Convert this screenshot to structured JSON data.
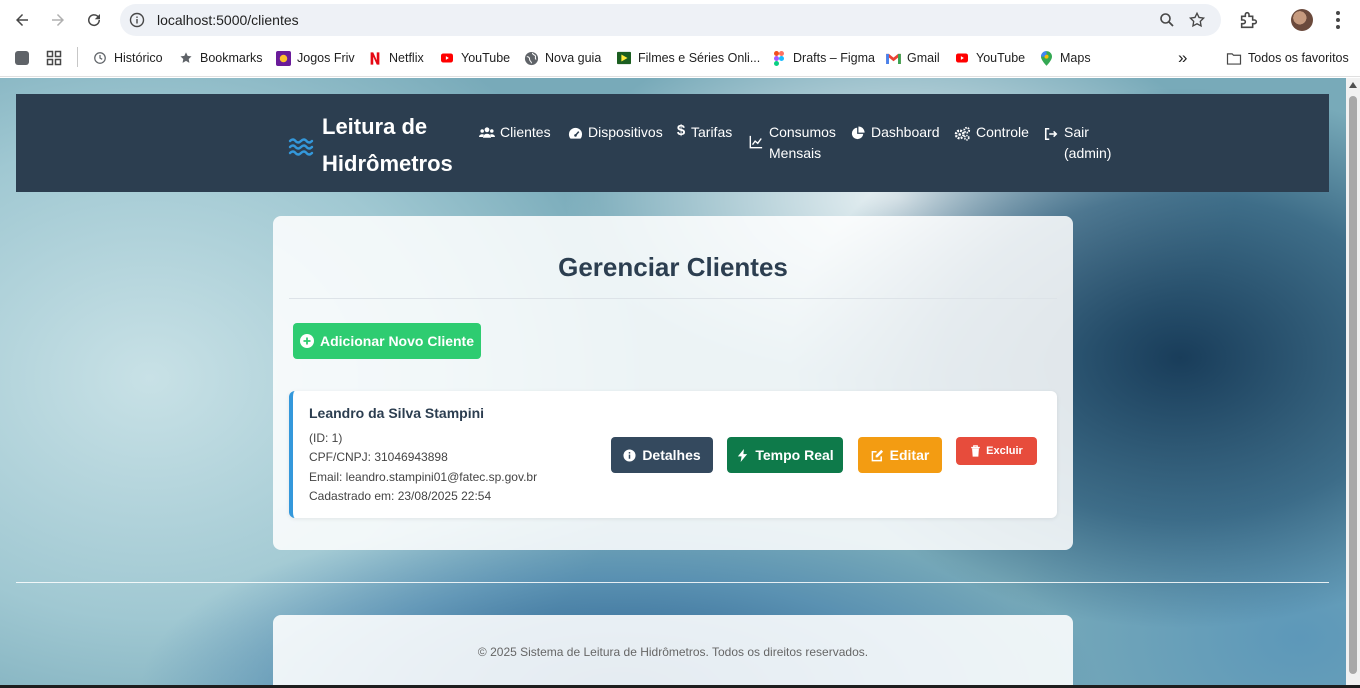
{
  "browser": {
    "url": "localhost:5000/clientes",
    "bookmarks": [
      {
        "label": "Histórico",
        "icon": "history-icon"
      },
      {
        "label": "Bookmarks",
        "icon": "star-icon"
      },
      {
        "label": "Jogos Friv",
        "icon": "friv-icon"
      },
      {
        "label": "Netflix",
        "icon": "netflix-icon"
      },
      {
        "label": "YouTube",
        "icon": "youtube-icon"
      },
      {
        "label": "Nova guia",
        "icon": "globe-icon"
      },
      {
        "label": "Filmes e Séries Onli...",
        "icon": "film-icon"
      },
      {
        "label": "Drafts – Figma",
        "icon": "figma-icon"
      },
      {
        "label": "Gmail",
        "icon": "gmail-icon"
      },
      {
        "label": "YouTube",
        "icon": "youtube-icon"
      },
      {
        "label": "Maps",
        "icon": "maps-icon"
      }
    ],
    "overflow_label": "»",
    "all_bookmarks": "Todos os favoritos"
  },
  "navbar": {
    "brand": "Leitura de Hidrômetros",
    "items": [
      {
        "label": "Clientes",
        "icon": "users-icon"
      },
      {
        "label": "Dispositivos",
        "icon": "gauge-icon"
      },
      {
        "label": "Tarifas",
        "icon": "dollar-icon"
      },
      {
        "label": "Consumos Mensais",
        "icon": "chart-line-icon"
      },
      {
        "label": "Dashboard",
        "icon": "pie-chart-icon"
      },
      {
        "label": "Controle",
        "icon": "cogs-icon"
      },
      {
        "label": "Sair (admin)",
        "icon": "sign-out-icon"
      }
    ]
  },
  "main": {
    "title": "Gerenciar Clientes",
    "add_button": "Adicionar Novo Cliente",
    "clients": [
      {
        "name": "Leandro da Silva Stampini",
        "id_line": "(ID: 1)",
        "doc_line": "CPF/CNPJ: 31046943898",
        "email_line": "Email: leandro.stampini01@fatec.sp.gov.br",
        "created_line": "Cadastrado em: 23/08/2025 22:54",
        "actions": {
          "details": "Detalhes",
          "realtime": "Tempo Real",
          "edit": "Editar",
          "delete": "Excluir"
        }
      }
    ]
  },
  "footer": {
    "text": "© 2025 Sistema de Leitura de Hidrômetros. Todos os direitos reservados."
  },
  "colors": {
    "navbar": "#2c3e50",
    "add": "#2ecc71",
    "details": "#34495e",
    "realtime": "#0e7a4a",
    "edit": "#f39c12",
    "delete": "#e74c3c",
    "accent": "#3498db"
  }
}
